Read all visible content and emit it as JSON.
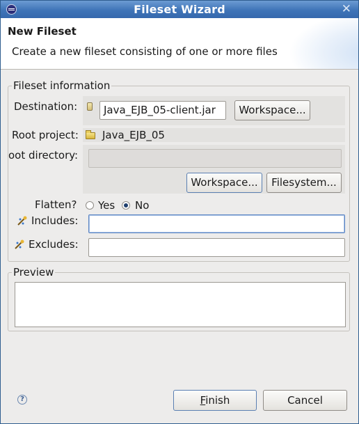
{
  "window": {
    "title": "Fileset Wizard",
    "close_glyph": "✕"
  },
  "header": {
    "title": "New Fileset",
    "description": "Create a new fileset consisting of one or more files"
  },
  "fileset_info": {
    "group_label": "Fileset information",
    "destination_label": "Destination:",
    "destination_value": "Java_EJB_05-client.jar",
    "destination_button": "Workspace...",
    "root_project_label": "Root project:",
    "root_project_value": "Java_EJB_05",
    "root_directory_label": "oot directory:",
    "root_directory_value": "",
    "root_dir_workspace_button": "Workspace...",
    "root_dir_filesystem_button": "Filesystem...",
    "flatten_label": "Flatten?",
    "flatten_yes": "Yes",
    "flatten_no": "No",
    "flatten_selected": "No",
    "includes_label": "Includes:",
    "includes_value": "",
    "excludes_label": "Excludes:",
    "excludes_value": ""
  },
  "preview": {
    "group_label": "Preview"
  },
  "footer": {
    "help_glyph": "?",
    "finish_mnemonic": "F",
    "finish_rest": "inish",
    "cancel_button": "Cancel"
  },
  "icons": {
    "app": "eclipse-icon",
    "jar": "jar-icon",
    "project": "folder-icon",
    "includes": "filter-icon",
    "excludes": "filter-icon",
    "help": "help-icon"
  }
}
